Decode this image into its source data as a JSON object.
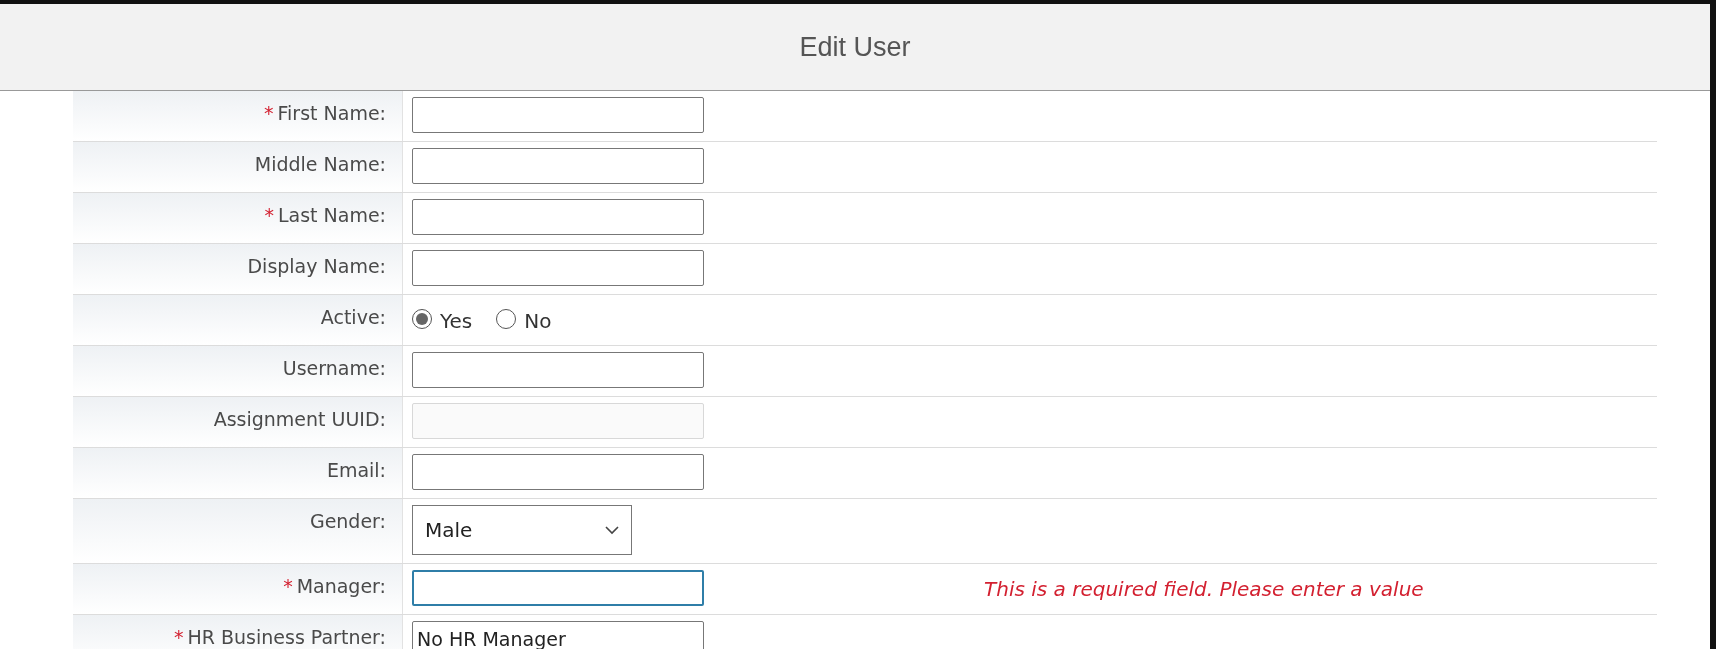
{
  "window": {
    "title": "Edit User"
  },
  "fields": [
    {
      "kind": "text",
      "marker": "*",
      "label": "First Name:"
    },
    {
      "kind": "text",
      "label": "Middle Name:"
    },
    {
      "kind": "text",
      "marker": "*",
      "label": "Last Name:"
    },
    {
      "kind": "text",
      "label": "Display Name:"
    },
    {
      "kind": "radio",
      "label": "Active:",
      "options": [
        {
          "label": "Yes",
          "selected": true
        },
        {
          "label": "No",
          "selected": false
        }
      ]
    },
    {
      "kind": "text",
      "label": "Username:"
    },
    {
      "kind": "text",
      "label": "Assignment UUID:",
      "disabled": true
    },
    {
      "kind": "text",
      "label": "Email:"
    },
    {
      "kind": "select",
      "label": "Gender:",
      "value": "Male"
    },
    {
      "kind": "text",
      "marker": "*",
      "label": "Manager:",
      "focused": true,
      "error": "This is a required field. Please enter a value"
    },
    {
      "kind": "text",
      "marker": "*",
      "label": "HR Business Partner:",
      "value": "No HR Manager"
    }
  ]
}
